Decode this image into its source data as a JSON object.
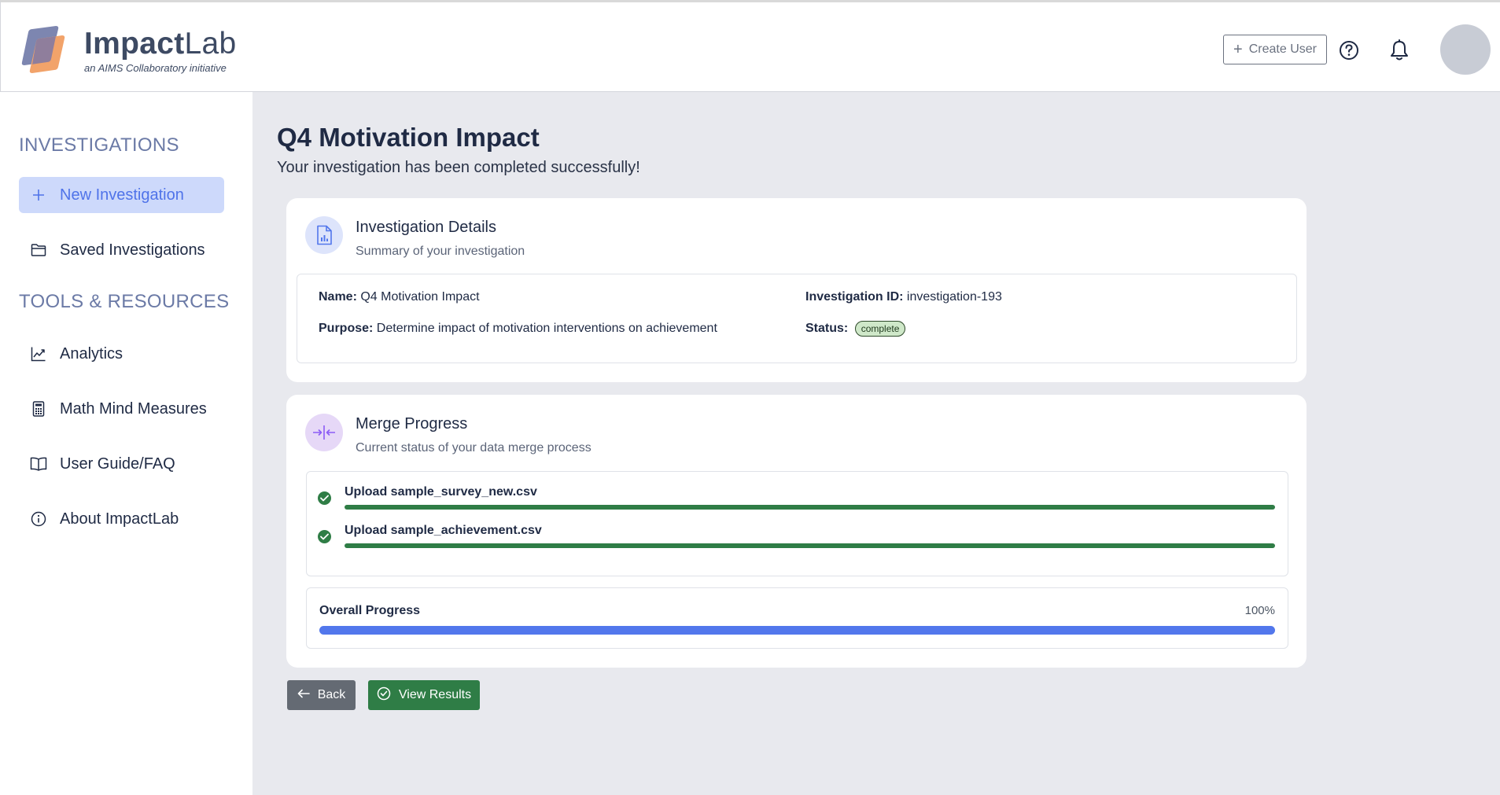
{
  "header": {
    "brand_bold": "Impact",
    "brand_light": "Lab",
    "tagline": "an AIMS Collaboratory initiative",
    "create_user_label": "Create User",
    "brand_colors": {
      "logo_back": "#7d86b0",
      "logo_front": "#f2a36a"
    }
  },
  "sidebar": {
    "section1_heading": "INVESTIGATIONS",
    "section2_heading": "TOOLS & RESOURCES",
    "items": [
      {
        "label": "New Investigation",
        "icon": "plus-icon",
        "active": true
      },
      {
        "label": "Saved Investigations",
        "icon": "folder-icon"
      },
      {
        "label": "Analytics",
        "icon": "chart-line-icon"
      },
      {
        "label": "Math Mind Measures",
        "icon": "calculator-icon"
      },
      {
        "label": "User Guide/FAQ",
        "icon": "book-icon"
      },
      {
        "label": "About ImpactLab",
        "icon": "info-icon"
      }
    ]
  },
  "main": {
    "title": "Q4 Motivation Impact",
    "subtitle": "Your investigation has been completed successfully!",
    "details_card": {
      "title": "Investigation Details",
      "subtitle": "Summary of your investigation",
      "name_label": "Name:",
      "name_value": "Q4 Motivation Impact",
      "purpose_label": "Purpose:",
      "purpose_value": "Determine impact of motivation interventions on achievement",
      "id_label": "Investigation ID:",
      "id_value": "investigation-193",
      "status_label": "Status:",
      "status_value": "complete"
    },
    "merge_card": {
      "title": "Merge Progress",
      "subtitle": "Current status of your data merge process",
      "steps": [
        {
          "label": "Upload sample_survey_new.csv",
          "progress": 1.0,
          "status": "done"
        },
        {
          "label": "Upload sample_achievement.csv",
          "progress": 1.0,
          "status": "done"
        }
      ],
      "overall_label": "Overall Progress",
      "overall_pct": "100%",
      "overall_progress": 1.0
    },
    "buttons": {
      "back_label": "Back",
      "results_label": "View Results"
    }
  }
}
